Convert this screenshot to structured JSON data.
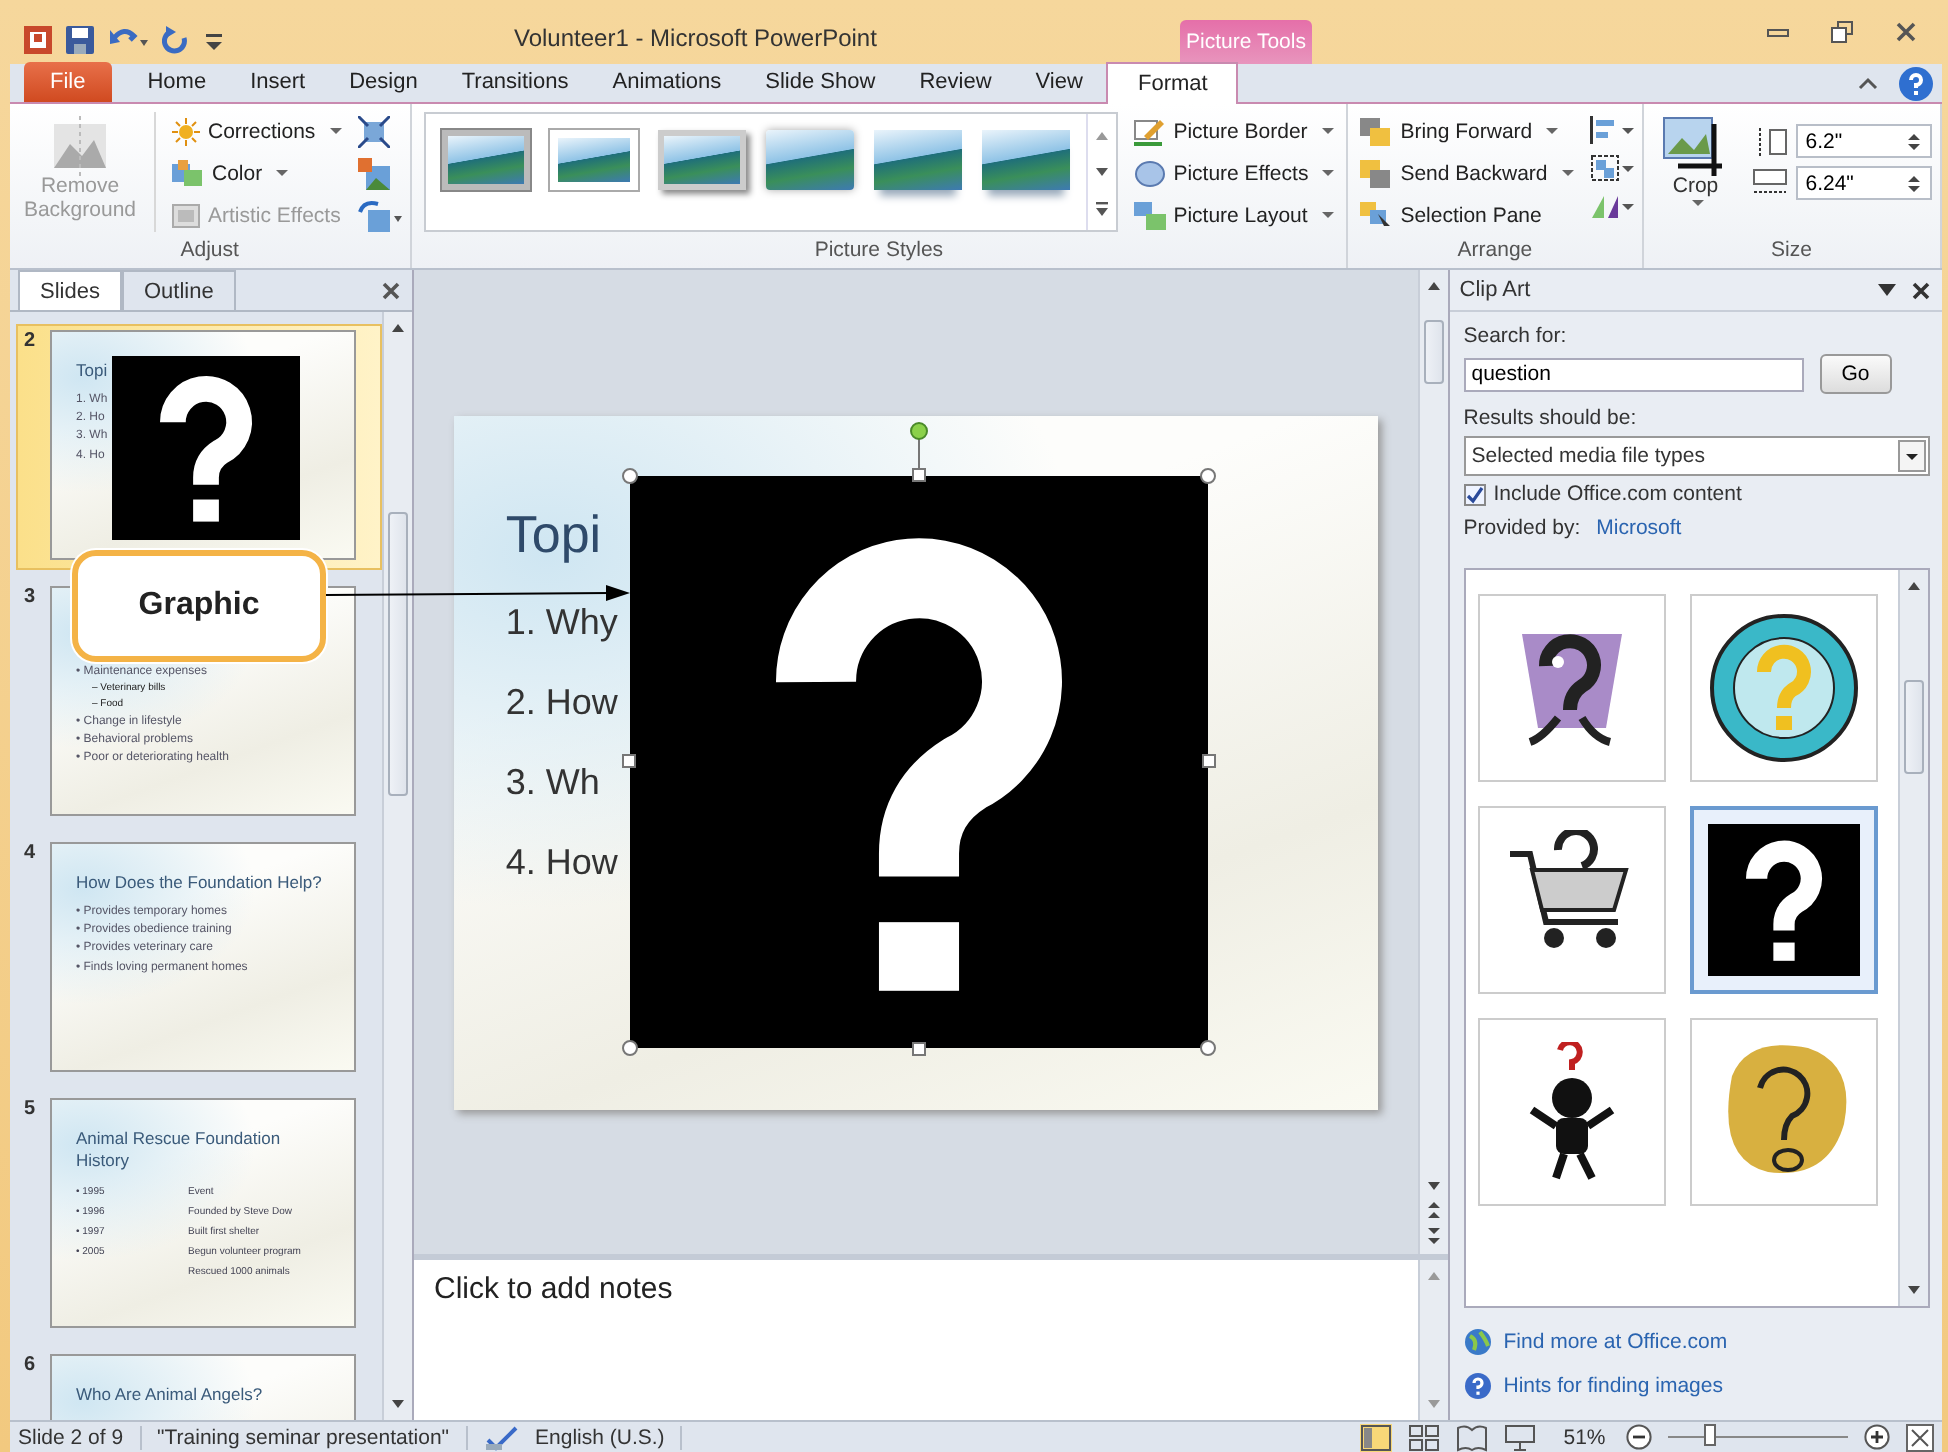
{
  "title_bar": {
    "title": "Volunteer1 - Microsoft PowerPoint",
    "contextual_label": "Picture Tools"
  },
  "tabs": [
    {
      "label": "File",
      "kind": "file",
      "selected": false
    },
    {
      "label": "Home",
      "kind": "plain",
      "selected": false
    },
    {
      "label": "Insert",
      "kind": "plain",
      "selected": false
    },
    {
      "label": "Design",
      "kind": "plain",
      "selected": false
    },
    {
      "label": "Transitions",
      "kind": "plain",
      "selected": false
    },
    {
      "label": "Animations",
      "kind": "plain",
      "selected": false
    },
    {
      "label": "Slide Show",
      "kind": "plain",
      "selected": false
    },
    {
      "label": "Review",
      "kind": "plain",
      "selected": false
    },
    {
      "label": "View",
      "kind": "plain",
      "selected": false
    },
    {
      "label": "Format",
      "kind": "contextual",
      "selected": true
    }
  ],
  "ribbon": {
    "adjust": {
      "label": "Adjust",
      "remove_background": {
        "label": "Remove Background",
        "disabled": true
      },
      "commands": [
        {
          "label": "Corrections",
          "disabled": false
        },
        {
          "label": "Color",
          "disabled": false
        },
        {
          "label": "Artistic Effects",
          "disabled": true
        }
      ]
    },
    "picture_styles": {
      "label": "Picture Styles",
      "styles": [
        {
          "kind": "frame"
        },
        {
          "kind": "white"
        },
        {
          "kind": "shadow"
        },
        {
          "kind": "soft"
        },
        {
          "kind": "reflect"
        },
        {
          "kind": "reflect"
        }
      ],
      "commands": [
        {
          "label": "Picture Border"
        },
        {
          "label": "Picture Effects"
        },
        {
          "label": "Picture Layout"
        }
      ]
    },
    "arrange": {
      "label": "Arrange",
      "commands": [
        {
          "label": "Bring Forward"
        },
        {
          "label": "Send Backward"
        },
        {
          "label": "Selection Pane"
        }
      ]
    },
    "size": {
      "label": "Size",
      "crop": "Crop",
      "height": "6.2\"",
      "width": "6.24\""
    }
  },
  "slides_panel": {
    "tabs": [
      {
        "label": "Slides",
        "selected": true
      },
      {
        "label": "Outline",
        "selected": false
      }
    ],
    "thumbnails": [
      {
        "number": "2",
        "selected": true,
        "kind": "picture",
        "title": "Topi",
        "bullets": [
          {
            "text": "1. Wh"
          },
          {
            "text": "2. Ho"
          },
          {
            "text": "3. Wh"
          },
          {
            "text": "4. Ho"
          }
        ]
      },
      {
        "number": "3",
        "selected": false,
        "kind": "bullets",
        "bullets": [
          {
            "text": "• Maintenance expenses",
            "children": [
              {
                "text": "– Veterinary bills"
              },
              {
                "text": "– Food"
              }
            ]
          },
          {
            "text": "• Change in lifestyle"
          },
          {
            "text": "• Behavioral problems"
          },
          {
            "text": "• Poor or deteriorating health"
          }
        ]
      },
      {
        "number": "4",
        "selected": false,
        "kind": "bullets",
        "title": "How Does the Foundation Help?",
        "bullets": [
          {
            "text": "• Provides temporary homes"
          },
          {
            "text": "• Provides obedience training"
          },
          {
            "text": "• Provides veterinary care"
          },
          {
            "text": "• Finds loving permanent homes"
          }
        ]
      },
      {
        "number": "5",
        "selected": false,
        "kind": "table",
        "title": "Animal Rescue Foundation History",
        "rows": [
          {
            "year": "• 1995",
            "event": "Event"
          },
          {
            "year": "• 1996",
            "event": "Founded by Steve Dow"
          },
          {
            "year": "• 1997",
            "event": "Built first shelter"
          },
          {
            "year": "• 2005",
            "event": "Begun volunteer program"
          },
          {
            "event": "Rescued 1000 animals"
          }
        ]
      },
      {
        "number": "6",
        "selected": false,
        "kind": "title",
        "title": "Who Are Animal Angels?"
      }
    ]
  },
  "slide": {
    "title": "Topi",
    "items": [
      "1. Why",
      "2. How",
      "3. Wh",
      "4. How"
    ]
  },
  "callout": {
    "label": "Graphic"
  },
  "notes": {
    "placeholder": "Click to add notes"
  },
  "clip_art": {
    "title": "Clip Art",
    "search_label": "Search for:",
    "search_value": "question",
    "go": "Go",
    "results_label": "Results should be:",
    "results_value": "Selected media file types",
    "include": {
      "label": "Include Office.com content",
      "checked": true
    },
    "provider_label": "Provided by:",
    "provider": "Microsoft",
    "results": [
      {
        "kind": "walker",
        "selected": false
      },
      {
        "kind": "badge",
        "selected": false
      },
      {
        "kind": "cart",
        "selected": false
      },
      {
        "kind": "sign",
        "selected": true
      },
      {
        "kind": "thinker",
        "selected": false
      },
      {
        "kind": "blob",
        "selected": false
      }
    ],
    "links": [
      {
        "kind": "globe",
        "label": "Find more at Office.com"
      },
      {
        "kind": "help",
        "label": "Hints for finding images"
      }
    ]
  },
  "status_bar": {
    "slide": "Slide 2 of 9",
    "theme": "\"Training seminar presentation\"",
    "language": "English (U.S.)",
    "zoom": "51%",
    "zoom_slider": {
      "level": 0.24
    }
  }
}
